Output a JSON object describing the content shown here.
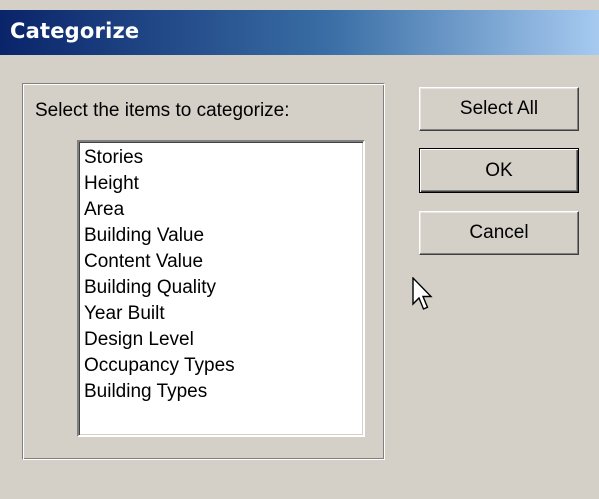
{
  "window": {
    "title": "Categorize"
  },
  "group": {
    "prompt": "Select the items to categorize:",
    "items": [
      "Stories",
      "Height",
      "Area",
      "Building Value",
      "Content Value",
      "Building Quality",
      "Year Built",
      "Design Level",
      "Occupancy Types",
      "Building Types"
    ]
  },
  "buttons": {
    "select_all": "Select All",
    "ok": "OK",
    "cancel": "Cancel"
  },
  "icons": {
    "cursor": "mouse-pointer-icon"
  },
  "colors": {
    "title_gradient_start": "#0a246a",
    "title_gradient_end": "#a6caf0",
    "face": "#d4d0c8",
    "list_bg": "#ffffff"
  }
}
